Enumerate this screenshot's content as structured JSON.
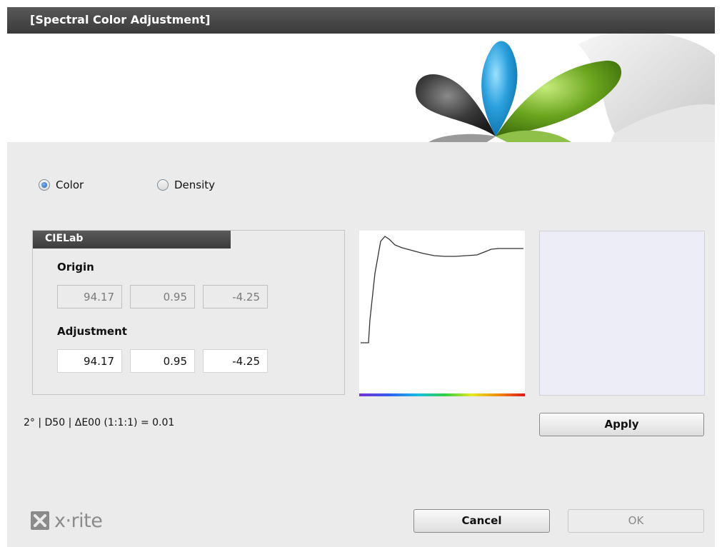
{
  "window": {
    "title": "[Spectral Color Adjustment]"
  },
  "mode": {
    "options": [
      {
        "label": "Color",
        "checked": true
      },
      {
        "label": "Density",
        "checked": false
      }
    ]
  },
  "cielab": {
    "header": "CIELab",
    "origin_label": "Origin",
    "origin_values": [
      "94.17",
      "0.95",
      "-4.25"
    ],
    "adjustment_label": "Adjustment",
    "adjustment_values": [
      "94.17",
      "0.95",
      "-4.25"
    ]
  },
  "swatch_color": "#ededf8",
  "status": {
    "delta_text": "2° | D50 | ΔE00 (1:1:1) = 0.01"
  },
  "buttons": {
    "apply": "Apply",
    "cancel": "Cancel",
    "ok": "OK"
  },
  "logo": {
    "text": "x·rite",
    "icon": "xrite-logo-icon"
  },
  "colors": {
    "titlebar": "#3a3a3a",
    "cyan_petal": "#2aa0dc",
    "green_petal": "#6aa51e",
    "dark_petal": "#3a3a3a"
  }
}
